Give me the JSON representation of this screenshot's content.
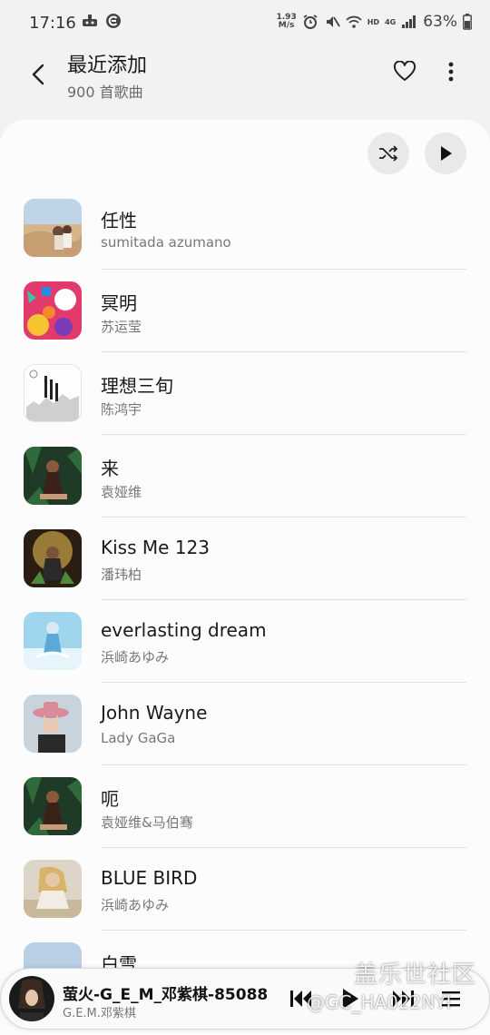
{
  "status_bar": {
    "time": "17:16",
    "net_speed_value": "1.93",
    "net_speed_unit": "M/s",
    "network_label": "HD",
    "signal_label": "4G",
    "battery": "63%"
  },
  "header": {
    "title": "最近添加",
    "subtitle": "900 首歌曲"
  },
  "songs": [
    {
      "title": "任性",
      "artist": "sumitada azumano"
    },
    {
      "title": "冥明",
      "artist": "苏运莹"
    },
    {
      "title": "理想三旬",
      "artist": "陈鸿宇"
    },
    {
      "title": "来",
      "artist": "袁娅维"
    },
    {
      "title": "Kiss Me 123",
      "artist": "潘玮柏"
    },
    {
      "title": "everlasting dream",
      "artist": "浜崎あゆみ"
    },
    {
      "title": "John Wayne",
      "artist": "Lady GaGa"
    },
    {
      "title": "呃",
      "artist": "袁娅维&马伯骞"
    },
    {
      "title": "BLUE BIRD",
      "artist": "浜崎あゆみ"
    },
    {
      "title": "白雪",
      "artist": ""
    }
  ],
  "mini_player": {
    "title": "萤火-G_E_M_邓紫棋-85088",
    "artist": "G.E.M.邓紫棋"
  },
  "watermark": {
    "line1": "盖乐世社区",
    "line2": "@GC_HA022NYI"
  },
  "colors": {
    "background": "#f2f2f2",
    "card": "#fcfcfc",
    "round_button": "#e9e9e9"
  }
}
